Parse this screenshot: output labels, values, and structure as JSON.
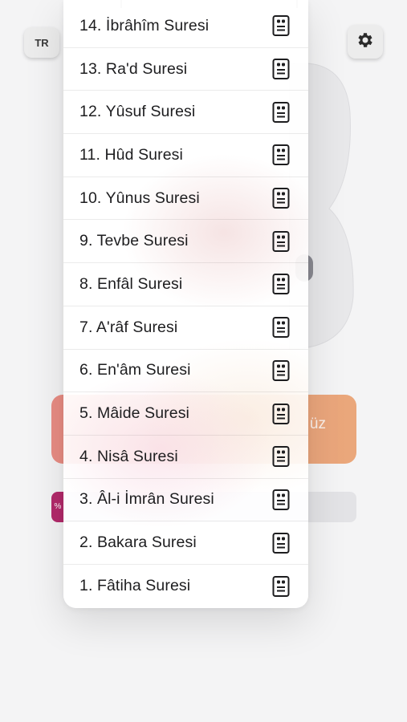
{
  "header": {
    "language_label": "TR",
    "settings_icon": "gear-icon"
  },
  "banner": {
    "text_fragment": "üz"
  },
  "progress": {
    "badge_text": "%"
  },
  "surah_menu": {
    "item_icon": "book-icon",
    "items": [
      {
        "label": "14. İbrâhîm Suresi"
      },
      {
        "label": "13. Ra'd Suresi"
      },
      {
        "label": "12. Yûsuf Suresi"
      },
      {
        "label": "11. Hûd Suresi"
      },
      {
        "label": "10. Yûnus Suresi"
      },
      {
        "label": "9. Tevbe Suresi"
      },
      {
        "label": "8. Enfâl Suresi"
      },
      {
        "label": "7. A'râf Suresi"
      },
      {
        "label": "6. En'âm Suresi"
      },
      {
        "label": "5. Mâide Suresi"
      },
      {
        "label": "4. Nisâ Suresi"
      },
      {
        "label": "3. Âl-i İmrân Suresi"
      },
      {
        "label": "2. Bakara Suresi"
      },
      {
        "label": "1. Fâtiha Suresi"
      }
    ]
  }
}
